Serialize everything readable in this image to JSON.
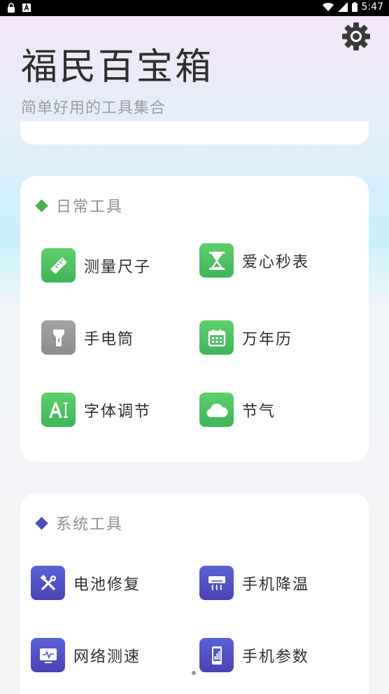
{
  "status_bar": {
    "time": "5:47",
    "left_icons": [
      "lock-icon",
      "text-a-icon"
    ],
    "right_icons": [
      "wifi-icon",
      "signal-icon",
      "battery-icon"
    ]
  },
  "header": {
    "title": "福民百宝箱",
    "subtitle": "简单好用的工具集合",
    "settings_icon": "gear-icon"
  },
  "sections": [
    {
      "title": "日常工具",
      "accent": "#4caf50",
      "tools": [
        {
          "label": "测量尺子",
          "icon": "ruler-icon",
          "color": "green"
        },
        {
          "label": "爱心秒表",
          "icon": "hourglass-icon",
          "color": "green"
        },
        {
          "label": "手电筒",
          "icon": "flashlight-icon",
          "color": "grey"
        },
        {
          "label": "万年历",
          "icon": "calendar-icon",
          "color": "green"
        },
        {
          "label": "字体调节",
          "icon": "font-size-icon",
          "color": "green"
        },
        {
          "label": "节气",
          "icon": "cloud-icon",
          "color": "green"
        }
      ]
    },
    {
      "title": "系统工具",
      "accent": "#4a4fb4",
      "tools": [
        {
          "label": "电池修复",
          "icon": "tools-icon",
          "color": "purple"
        },
        {
          "label": "手机降温",
          "icon": "air-conditioner-icon",
          "color": "purple"
        },
        {
          "label": "网络测速",
          "icon": "monitor-pulse-icon",
          "color": "purple"
        },
        {
          "label": "手机参数",
          "icon": "phone-chart-icon",
          "color": "purple"
        }
      ]
    }
  ]
}
